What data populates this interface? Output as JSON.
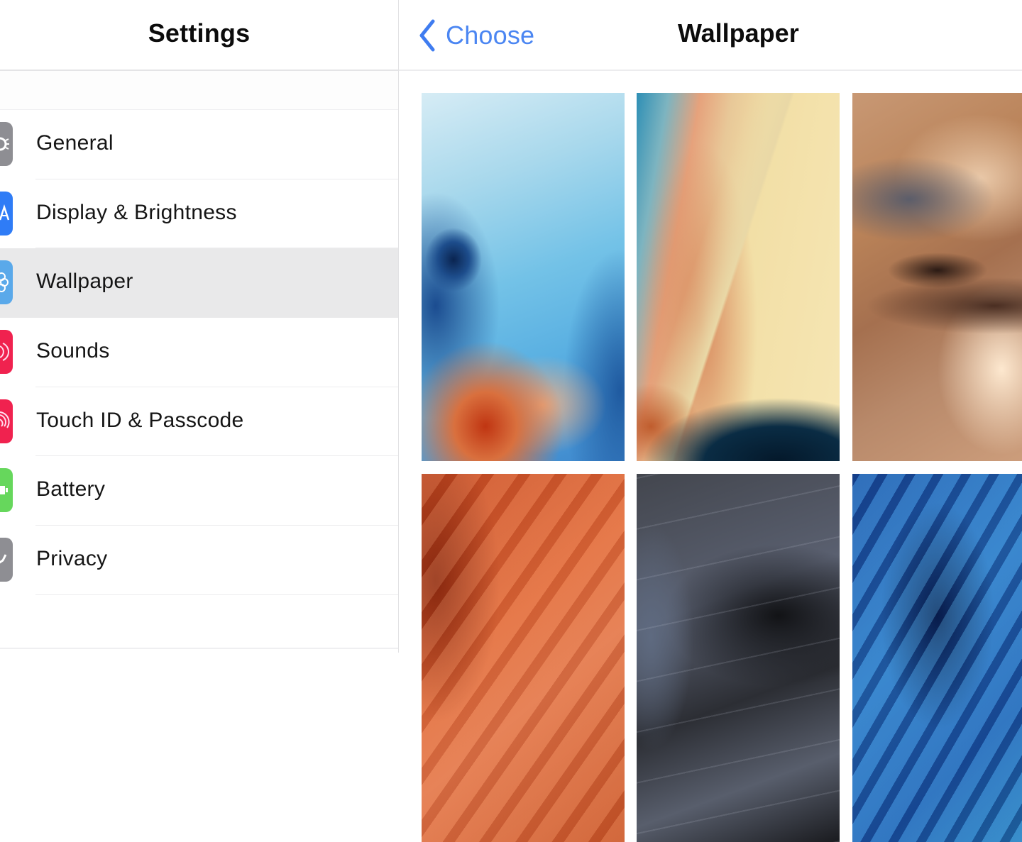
{
  "sidebar": {
    "title": "Settings",
    "items": [
      {
        "label": "General",
        "icon": "gear-icon",
        "color": "#8e8e93",
        "glyph": "⚙",
        "selected": false
      },
      {
        "label": "Display & Brightness",
        "icon": "display-brightness-icon",
        "color": "#2f7cf6",
        "glyph": "A",
        "selected": false
      },
      {
        "label": "Wallpaper",
        "icon": "wallpaper-flower-icon",
        "color": "#5aa9ea",
        "glyph": "✿",
        "selected": true
      },
      {
        "label": "Sounds",
        "icon": "speaker-sound-icon",
        "color": "#f0224f",
        "glyph": ")",
        "selected": false
      },
      {
        "label": "Touch ID & Passcode",
        "icon": "fingerprint-icon",
        "color": "#f0224f",
        "glyph": ")",
        "selected": false
      },
      {
        "label": "Battery",
        "icon": "battery-icon",
        "color": "#66d75c",
        "glyph": "▮",
        "selected": false
      },
      {
        "label": "Privacy",
        "icon": "hand-privacy-icon",
        "color": "#8e8e93",
        "glyph": "✋",
        "selected": false
      }
    ]
  },
  "detail": {
    "back_label": "Choose",
    "back_icon": "chevron-left-icon",
    "title": "Wallpaper",
    "accent_color": "#3f7cf0",
    "wallpapers": [
      {
        "name": "blue-ice-wallpaper",
        "description": "Blue ice with orange ripples"
      },
      {
        "name": "sand-streak-wallpaper",
        "description": "Sand with teal and orange streak"
      },
      {
        "name": "desert-dunes-wallpaper",
        "description": "Brown desert dunes"
      },
      {
        "name": "orange-feathers-wallpaper",
        "description": "Orange feathers"
      },
      {
        "name": "dark-feathers-wallpaper",
        "description": "Dark grey feathers"
      },
      {
        "name": "blue-feathers-wallpaper",
        "description": "Blue feathers"
      }
    ]
  }
}
